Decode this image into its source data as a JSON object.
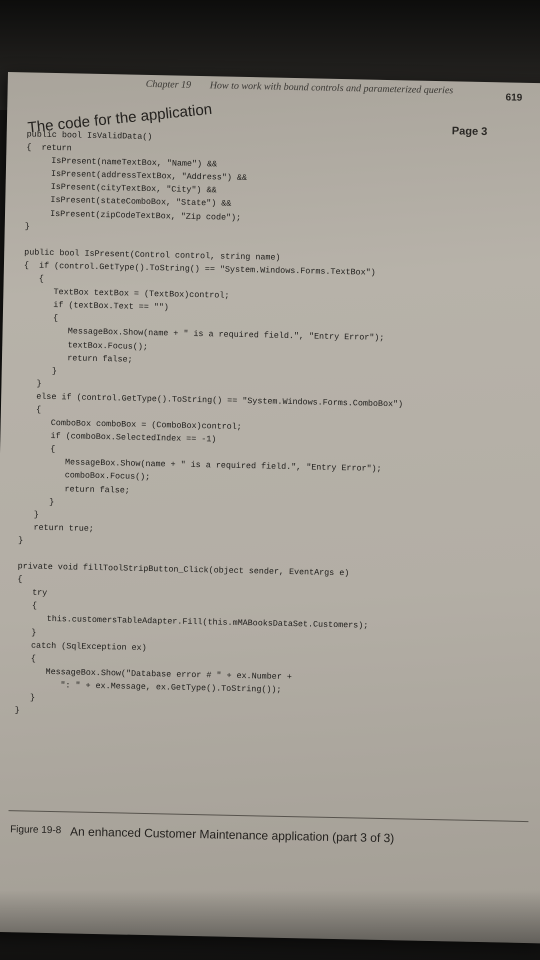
{
  "header": {
    "chapter": "Chapter 19",
    "title": "How to work with bound controls and parameterized queries",
    "page_number": "619"
  },
  "heading": "The code for the application",
  "part_label": "Page 3",
  "code_lines": [
    "public bool IsValidData()",
    "{  return",
    "     IsPresent(nameTextBox, \"Name\") &&",
    "     IsPresent(addressTextBox, \"Address\") &&",
    "     IsPresent(cityTextBox, \"City\") &&",
    "     IsPresent(stateComboBox, \"State\") &&",
    "     IsPresent(zipCodeTextBox, \"Zip code\");",
    "}",
    "public bool IsPresent(Control control, string name)",
    "{  if (control.GetType().ToString() == \"System.Windows.Forms.TextBox\")",
    "   {",
    "      TextBox textBox = (TextBox)control;",
    "      if (textBox.Text == \"\")",
    "      {",
    "         MessageBox.Show(name + \" is a required field.\", \"Entry Error\");",
    "         textBox.Focus();",
    "         return false;",
    "      }",
    "   }",
    "   else if (control.GetType().ToString() == \"System.Windows.Forms.ComboBox\")",
    "   {",
    "      ComboBox comboBox = (ComboBox)control;",
    "      if (comboBox.SelectedIndex == -1)",
    "      {",
    "         MessageBox.Show(name + \" is a required field.\", \"Entry Error\");",
    "         comboBox.Focus();",
    "         return false;",
    "      }",
    "   }",
    "   return true;",
    "}",
    "private void fillToolStripButton_Click(object sender, EventArgs e)",
    "{",
    "   try",
    "   {",
    "      this.customersTableAdapter.Fill(this.mMABooksDataSet.Customers);",
    "   }",
    "   catch (SqlException ex)",
    "   {",
    "      MessageBox.Show(\"Database error # \" + ex.Number +",
    "         \": \" + ex.Message, ex.GetType().ToString());",
    "   }",
    "}"
  ],
  "caption": {
    "figure_number": "Figure 19-8",
    "text": "An enhanced Customer Maintenance application (part 3 of 3)"
  }
}
